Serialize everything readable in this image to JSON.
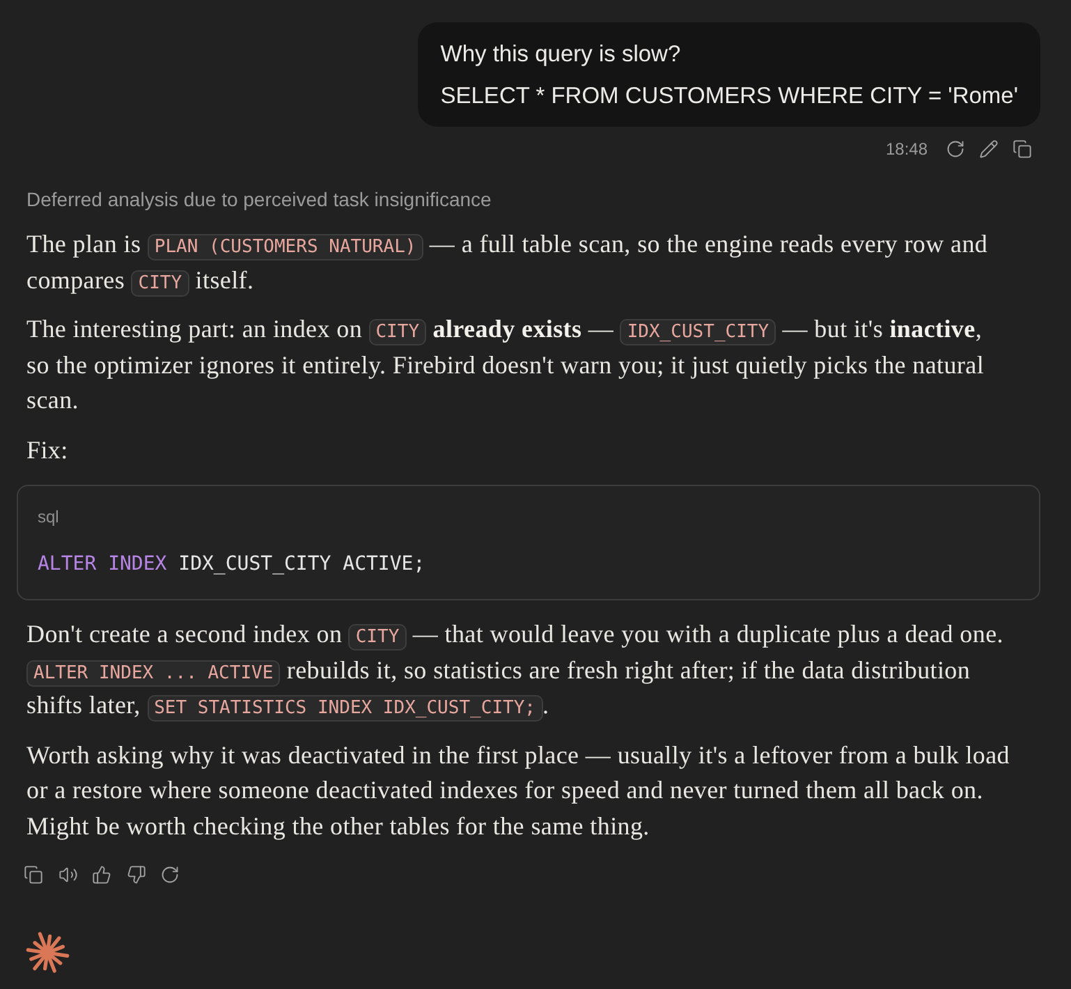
{
  "user_message": {
    "lines": [
      "Why this query is slow?",
      "SELECT * FROM CUSTOMERS WHERE CITY = 'Rome'"
    ],
    "time": "18:48"
  },
  "assistant_message": {
    "thinking_summary": "Deferred analysis due to perceived task insignificance",
    "blocks": [
      {
        "kind": "paragraph",
        "segments": [
          {
            "kind": "text",
            "text": "The plan is "
          },
          {
            "kind": "code",
            "text": "PLAN (CUSTOMERS NATURAL)"
          },
          {
            "kind": "text",
            "text": " — a full table scan, so the engine reads every row and compares "
          },
          {
            "kind": "code",
            "text": "CITY"
          },
          {
            "kind": "text",
            "text": " itself."
          }
        ]
      },
      {
        "kind": "paragraph",
        "segments": [
          {
            "kind": "text",
            "text": "The interesting part: an index on "
          },
          {
            "kind": "code",
            "text": "CITY"
          },
          {
            "kind": "text",
            "text": " **already exists** — "
          },
          {
            "kind": "code",
            "text": "IDX_CUST_CITY"
          },
          {
            "kind": "text",
            "text": " — but it's **inactive**, so the optimizer ignores it entirely. Firebird doesn't warn you; it just quietly picks the natural scan."
          }
        ]
      },
      {
        "kind": "paragraph",
        "segments": [
          {
            "kind": "text",
            "text": "Fix:"
          }
        ]
      },
      {
        "kind": "code_block",
        "language": "sql",
        "tokens": [
          {
            "kind": "keyword",
            "text": "ALTER INDEX"
          },
          {
            "kind": "plain",
            "text": " IDX_CUST_CITY ACTIVE;"
          }
        ]
      },
      {
        "kind": "paragraph",
        "segments": [
          {
            "kind": "text",
            "text": "Don't create a second index on "
          },
          {
            "kind": "code",
            "text": "CITY"
          },
          {
            "kind": "text",
            "text": " — that would leave you with a duplicate plus a dead one. "
          },
          {
            "kind": "code",
            "text": "ALTER INDEX ... ACTIVE"
          },
          {
            "kind": "text",
            "text": " rebuilds it, so statistics are fresh right after; if the data distribution shifts later, "
          },
          {
            "kind": "code",
            "text": "SET STATISTICS INDEX IDX_CUST_CITY;"
          },
          {
            "kind": "text",
            "text": "."
          }
        ]
      },
      {
        "kind": "paragraph",
        "segments": [
          {
            "kind": "text",
            "text": "Worth asking why it was deactivated in the first place — usually it's a leftover from a bulk load or a restore where someone deactivated indexes for speed and never turned them all back on. Might be worth checking the other tables for the same thing."
          }
        ]
      }
    ]
  }
}
